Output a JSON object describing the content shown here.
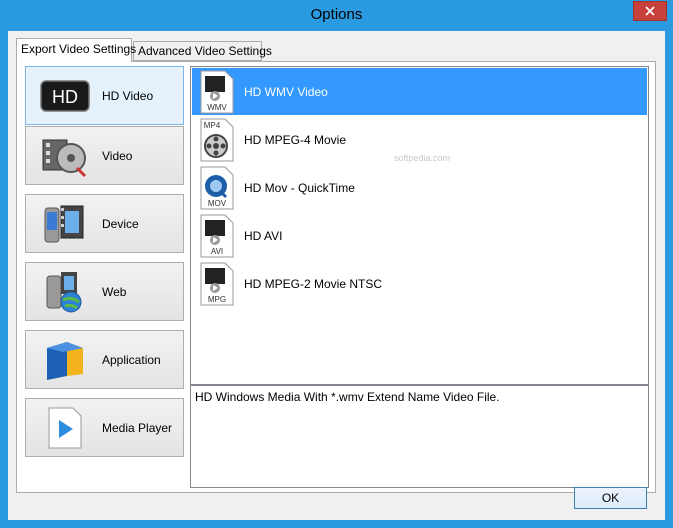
{
  "window": {
    "title": "Options"
  },
  "tabs": [
    {
      "label": "Export Video Settings",
      "active": true
    },
    {
      "label": "Advanced Video Settings",
      "active": false
    }
  ],
  "categories": [
    {
      "label": "HD Video",
      "icon": "hd-icon",
      "selected": true
    },
    {
      "label": "Video",
      "icon": "film-reel-icon",
      "selected": false
    },
    {
      "label": "Device",
      "icon": "device-icon",
      "selected": false
    },
    {
      "label": "Web",
      "icon": "web-globe-icon",
      "selected": false
    },
    {
      "label": "Application",
      "icon": "application-icon",
      "selected": false
    },
    {
      "label": "Media Player",
      "icon": "play-icon",
      "selected": false
    }
  ],
  "formats": [
    {
      "label": "HD WMV Video",
      "badge": "WMV",
      "selected": true
    },
    {
      "label": "HD MPEG-4 Movie",
      "badge": "MP4",
      "selected": false
    },
    {
      "label": "HD Mov - QuickTime",
      "badge": "MOV",
      "selected": false
    },
    {
      "label": "HD AVI",
      "badge": "AVI",
      "selected": false
    },
    {
      "label": "HD MPEG-2 Movie NTSC",
      "badge": "MPG",
      "selected": false
    }
  ],
  "description": "HD Windows Media With *.wmv Extend Name Video File.",
  "ok_label": "OK",
  "watermark": "softpedia.com",
  "colors": {
    "selection": "#3399ff",
    "close": "#c7413c",
    "titlebar": "#2a9be0"
  }
}
